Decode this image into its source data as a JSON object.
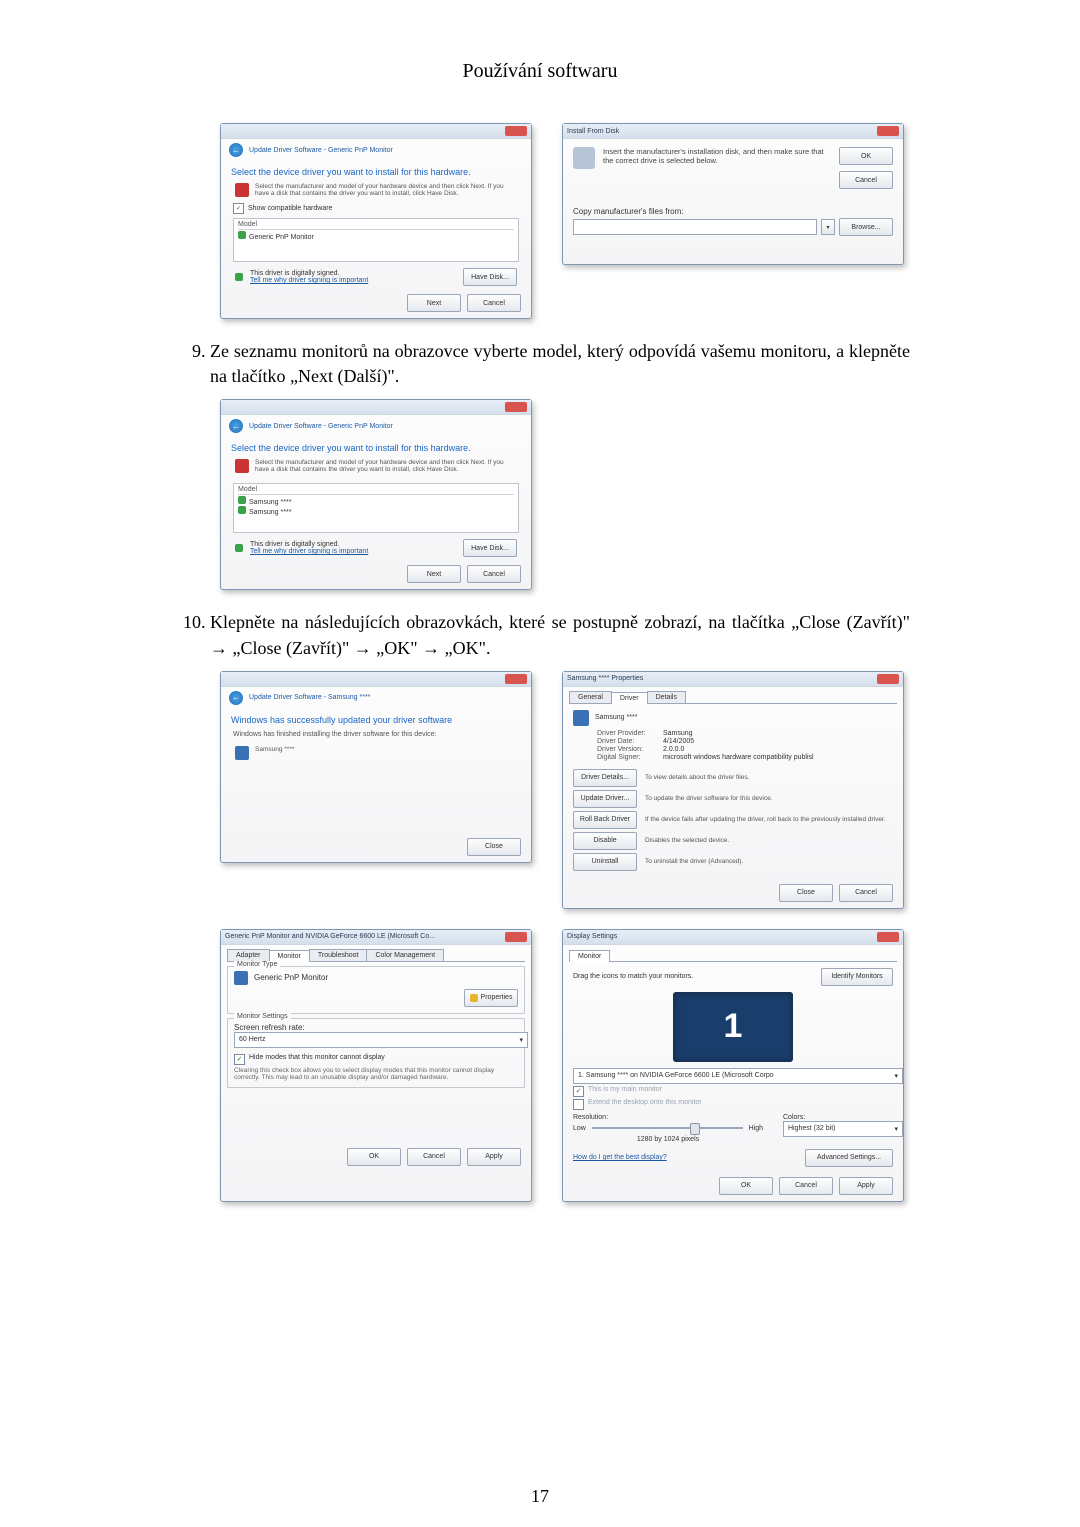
{
  "page": {
    "title": "Používání softwaru",
    "number": "17"
  },
  "steps": {
    "nine_number": 9,
    "nine_text": "Ze seznamu monitorů na obrazovce vyberte model, který odpovídá vašemu monitoru, a klepněte na tlačítko „Next (Další)\".",
    "ten_number": 10,
    "ten_text": "Klepněte na následujících obrazovkách, které se postupně zobrazí, na tlačítka „Close (Zavřít)\" → „Close (Zavřít)\" → „OK\" → „OK\"."
  },
  "wiz1": {
    "breadcrumb": "Update Driver Software - Generic PnP Monitor",
    "heading": "Select the device driver you want to install for this hardware.",
    "sub": "Select the manufacturer and model of your hardware device and then click Next. If you have a disk that contains the driver you want to install, click Have Disk.",
    "show_compat": "Show compatible hardware",
    "model_hdr": "Model",
    "model_item": "Generic PnP Monitor",
    "signed": "This driver is digitally signed.",
    "why_link": "Tell me why driver signing is important",
    "have_disk": "Have Disk...",
    "next": "Next",
    "cancel": "Cancel"
  },
  "ifd": {
    "title": "Install From Disk",
    "text": "Insert the manufacturer's installation disk, and then make sure that the correct drive is selected below.",
    "ok": "OK",
    "cancel": "Cancel",
    "copy_label": "Copy manufacturer's files from:",
    "browse": "Browse..."
  },
  "wiz2": {
    "breadcrumb": "Update Driver Software - Generic PnP Monitor",
    "heading": "Select the device driver you want to install for this hardware.",
    "sub": "Select the manufacturer and model of your hardware device and then click Next. If you have a disk that contains the driver you want to install, click Have Disk.",
    "model_hdr": "Model",
    "item1": "Samsung ****",
    "item2": "Samsung ****",
    "signed": "This driver is digitally signed.",
    "why_link": "Tell me why driver signing is important",
    "have_disk": "Have Disk...",
    "next": "Next",
    "cancel": "Cancel"
  },
  "wiz3": {
    "breadcrumb": "Update Driver Software - Samsung ****",
    "success": "Windows has successfully updated your driver software",
    "finished": "Windows has finished installing the driver software for this device:",
    "device": "Samsung ****",
    "close": "Close"
  },
  "drvprop": {
    "title": "Samsung **** Properties",
    "tab_general": "General",
    "tab_driver": "Driver",
    "tab_details": "Details",
    "device": "Samsung ****",
    "provider_k": "Driver Provider:",
    "provider_v": "Samsung",
    "date_k": "Driver Date:",
    "date_v": "4/14/2005",
    "version_k": "Driver Version:",
    "version_v": "2.0.0.0",
    "signer_k": "Digital Signer:",
    "signer_v": "microsoft windows hardware compatibility publisl",
    "details_btn": "Driver Details...",
    "details_txt": "To view details about the driver files.",
    "update_btn": "Update Driver...",
    "update_txt": "To update the driver software for this device.",
    "rollback_btn": "Roll Back Driver",
    "rollback_txt": "If the device fails after updating the driver, roll back to the previously installed driver.",
    "disable_btn": "Disable",
    "disable_txt": "Disables the selected device.",
    "uninstall_btn": "Uninstall",
    "uninstall_txt": "To uninstall the driver (Advanced).",
    "close": "Close",
    "cancel": "Cancel"
  },
  "monprop": {
    "title": "Generic PnP Monitor and NVIDIA GeForce 6600 LE (Microsoft Co...",
    "tab_adapter": "Adapter",
    "tab_monitor": "Monitor",
    "tab_trouble": "Troubleshoot",
    "tab_color": "Color Management",
    "grp_type": "Monitor Type",
    "type_val": "Generic PnP Monitor",
    "properties": "Properties",
    "grp_settings": "Monitor Settings",
    "refresh_lbl": "Screen refresh rate:",
    "refresh_val": "60 Hertz",
    "hide_chk": "Hide modes that this monitor cannot display",
    "hide_note": "Clearing this check box allows you to select display modes that this monitor cannot display correctly. This may lead to an unusable display and/or damaged hardware.",
    "ok": "OK",
    "cancel": "Cancel",
    "apply": "Apply"
  },
  "dispset": {
    "title": "Display Settings",
    "tab_monitor": "Monitor",
    "drag": "Drag the icons to match your monitors.",
    "identify": "Identify Monitors",
    "big": "1",
    "combo": "1. Samsung **** on NVIDIA GeForce 6600 LE (Microsoft Corpo",
    "main_chk": "This is my main monitor",
    "extend_chk": "Extend the desktop onto this monitor",
    "res_lbl": "Resolution:",
    "low": "Low",
    "high": "High",
    "res_val": "1280 by 1024 pixels",
    "colors_lbl": "Colors:",
    "colors_val": "Highest (32 bit)",
    "howlink": "How do I get the best display?",
    "adv": "Advanced Settings...",
    "ok": "OK",
    "cancel": "Cancel",
    "apply": "Apply"
  }
}
